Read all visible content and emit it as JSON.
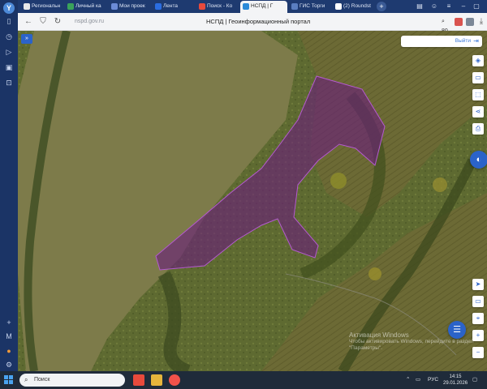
{
  "browser": {
    "tabs": [
      {
        "label": "Региональн",
        "color": "#e8e8e8"
      },
      {
        "label": "Личный ка",
        "color": "#3aa35b"
      },
      {
        "label": "Мои проек",
        "color": "#6b8bd6"
      },
      {
        "label": "Лента",
        "color": "#2b6de0"
      },
      {
        "label": "Поиск - Ко",
        "color": "#e84a3c"
      },
      {
        "label": "НСПД | Г",
        "color": "#2b8ad8"
      },
      {
        "label": "ГИС Торги",
        "color": "#5a7ec0"
      },
      {
        "label": "(2) Roundst",
        "color": "#ffffff"
      }
    ],
    "active_tab_index": 5,
    "new_tab": "+",
    "url": "nspd.gov.ru",
    "page_title": "НСПД | Геоинформационный портал",
    "zoom": "80 %"
  },
  "portal": {
    "logout_label": "Выйти",
    "collapse_label": "»"
  },
  "watermark": {
    "line1": "Активация Windows",
    "line2": "Чтобы активировать Windows, перейдите в раздел",
    "line3": "\"Параметры\"."
  },
  "taskbar": {
    "search_placeholder": "Поиск",
    "lang": "РУС",
    "time": "14:15",
    "date": "29.01.2026"
  },
  "colors": {
    "parcel_fill": "#6a1f7a",
    "parcel_stroke": "#b45ad0",
    "accent": "#2b63c9"
  }
}
